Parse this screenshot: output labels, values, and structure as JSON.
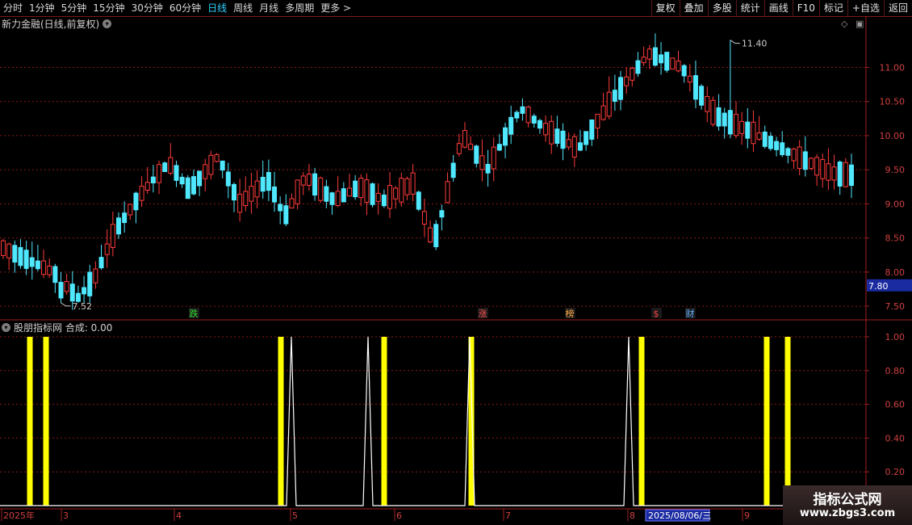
{
  "toolbar": {
    "periods": [
      "分时",
      "1分钟",
      "5分钟",
      "15分钟",
      "30分钟",
      "60分钟",
      "日线",
      "周线",
      "月线",
      "多周期",
      "更多 >"
    ],
    "active_period": "日线",
    "buttons": [
      "复权",
      "叠加",
      "多股",
      "统计",
      "画线",
      "F10",
      "标记",
      "+自选",
      "返回"
    ]
  },
  "chart_title": "新力金融(日线,前复权)",
  "price_axis": {
    "ticks": [
      "11.00",
      "10.50",
      "10.00",
      "9.50",
      "9.00",
      "8.50",
      "8.00",
      "7.50"
    ],
    "current_label": "7.80"
  },
  "price_annotations": {
    "high": "11.40",
    "low": "7.52"
  },
  "event_markers": [
    {
      "label": "跌",
      "color": "#33dd33"
    },
    {
      "label": "涨",
      "color": "#ff5050"
    },
    {
      "label": "榜",
      "color": "#ffaa44"
    },
    {
      "label": "$",
      "color": "#ff4040"
    },
    {
      "label": "财",
      "color": "#66b0ff"
    }
  ],
  "indicator": {
    "title": "股朋指标网 合成: 0.00",
    "ticks": [
      "1.00",
      "0.80",
      "0.60",
      "0.40",
      "0.20"
    ]
  },
  "date_axis": {
    "labels": [
      "2025年",
      "3",
      "4",
      "5",
      "6",
      "7",
      "8",
      "9"
    ],
    "cursor_date": "2025/08/06/三"
  },
  "watermark": {
    "title": "指标公式网",
    "url": "www.zbgs3.com"
  },
  "colors": {
    "up": "#ff3b3b",
    "down": "#4fe8ff",
    "indicator_bar": "#ffff00",
    "indicator_line": "#ffffff",
    "grid": "#8a1a1a"
  }
}
